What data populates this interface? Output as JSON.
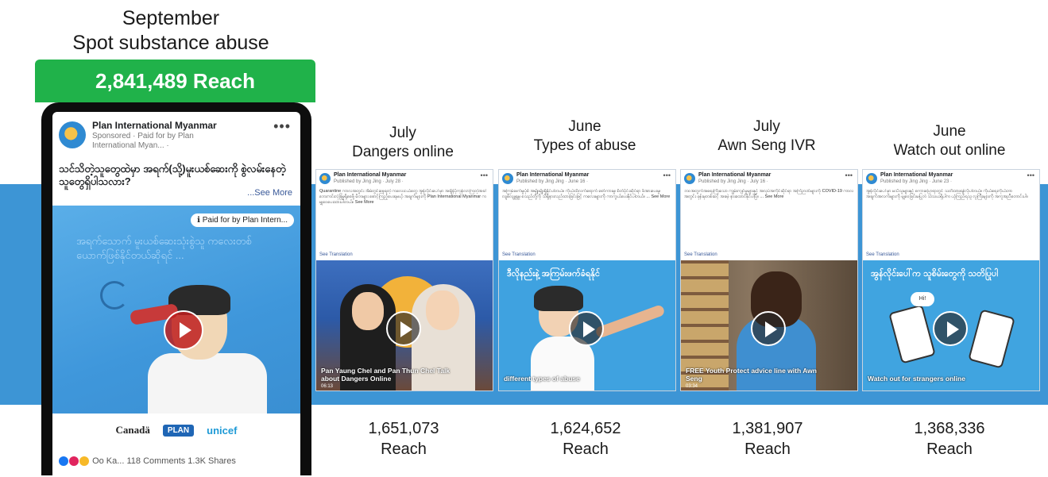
{
  "feature": {
    "month": "September",
    "title": "Spot substance abuse",
    "reach_banner": "2,841,489 Reach",
    "post": {
      "page_name": "Plan International Myanmar",
      "sponsored_line": "Sponsored · Paid for by Plan International Myan... ·",
      "text": "သင်သိတဲ့သူတွေထဲမှာ အရက်(သို့)မူးယစ်ဆေးကို စွဲလမ်းနေတဲ့သူတွေရှိပါသလား?",
      "see_more": "...See More",
      "paid_pill": "Paid for by Plan Intern...",
      "video_text": "အရက်သောက် မူးယစ်ဆေးသုံးစွဲသူ ကလေးတစ်ယောက်ဖြစ်နိုင်တယ်ဆိုရင် ...",
      "logos": {
        "canada": "Canadä",
        "plan": "PLAN",
        "unicef": "unicef"
      },
      "reactions": "Oo Ka...  118 Comments  1.3K Shares"
    }
  },
  "cards": [
    {
      "month": "July",
      "title": "Dangers online",
      "reach_value": "1,651,073",
      "reach_label": "Reach",
      "page_name": "Plan International Myanmar",
      "published": "Published by Jing Jing · July 28 ·",
      "text": "Quarantine ကာလအတွင်း အိမ်တွင်းနေရတဲ့ ကလေးငယ်တွေ အွန်လိုင်းပေါ်မှာ အချိန်ပိုကုန်လာကြတဲ့အခါ ဘေးကင်းလုံခြုံမှုရှိစေဖို့ မိဘများ စောင့်ကြည့်ပေးရမယ့် အချက်များကို Plan International Myanmar က မျှဝေပေးထားပါတယ်။ See More",
      "see_translation": "See Translation",
      "caption": "Pan Yaung Chel and Pan Thun Chel Talk about Dangers Online",
      "time": "06:13",
      "banner": "",
      "scene": "talk"
    },
    {
      "month": "June",
      "title": "Types of abuse",
      "reach_value": "1,624,652",
      "reach_label": "Reach",
      "page_name": "Plan International Myanmar",
      "published": "Published by Jing Jing · June 16 ·",
      "text": "အကြမ်းဖက်မှုပုံစံ အမျိုးမျိုးရှိနိုင်ပါတယ်။ ကိုယ်ထိလက်ရောက် စော်ကားမှု၊ စိတ်ပိုင်းဆိုင်ရာ ဖိအားပေးမှု၊ လျစ်လျူရှုမှု စသည်တို့ကို သိရှိနားလည်ထားခြင်းဖြင့် ကလေးများကို ကာကွယ်ပေးနိုင်ပါတယ်။ ... See More",
      "see_translation": "See Translation",
      "caption": "different types of abuse",
      "time": "",
      "banner": "ဒီလိုနည်းနဲ့ အကြမ်းဖက်ခံရနိုင်",
      "scene": "cartoon"
    },
    {
      "month": "July",
      "title": "Awn Seng IVR",
      "reach_value": "1,381,907",
      "reach_label": "Reach",
      "page_name": "Plan International Myanmar",
      "published": "Published by Jing Jing · July 16 ·",
      "text": "ဘဝအတွက်အရေးကြီးသော ကျွမ်းကျင်မှုများနှင့် အလုပ်အကိုင်ဆိုင်ရာ အကြံဉာဏ်များကို COVID-19 ကာလအတွင်း ဖုန်းမှတစ်ဆင့် အခမဲ့ နားထောင်နိုင်ပါပြီ။ ... See More",
      "see_translation": "See Translation",
      "caption": "FREE Youth Protect advice line with Awn Seng",
      "time": "03:34",
      "banner": "",
      "scene": "presenter"
    },
    {
      "month": "June",
      "title": "Watch out online",
      "reach_value": "1,368,336",
      "reach_label": "Reach",
      "page_name": "Plan International Myanmar",
      "published": "Published by Jing Jing · June 23 ·",
      "text": "အွန်လိုင်းပေါ်မှာ မသိသူများနှင့် စကားပြောရာတွင် သတိထားရန်လိုပါတယ်။ ကိုယ်ရေးကိုယ်တာ အချက်အလက်များကို မျှဝေခြင်းမပြုဘဲ သံသယရှိပါက ယုံကြည်ရသူ လူကြီးများကို အကူအညီတောင်းပါ။",
      "see_translation": "See Translation",
      "caption": "Watch out for strangers online",
      "time": "",
      "banner": "အွန်လိုင်းပေါ်က သူစိမ်းတွေကို သတိပြုပါ",
      "scene": "phones"
    }
  ]
}
